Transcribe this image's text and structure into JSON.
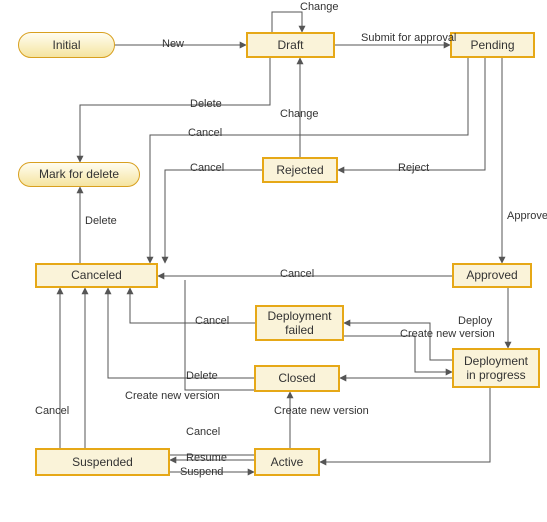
{
  "nodes": {
    "initial": "Initial",
    "draft": "Draft",
    "pending": "Pending",
    "rejected": "Rejected",
    "mark_for_delete": "Mark for delete",
    "canceled": "Canceled",
    "approved": "Approved",
    "deployment_failed": "Deployment failed",
    "deployment_in_progress": "Deployment in progress",
    "closed": "Closed",
    "active": "Active",
    "suspended": "Suspended"
  },
  "edges": {
    "new": "New",
    "change_self": "Change",
    "submit_for_approval": "Submit for approval",
    "reject": "Reject",
    "change_back": "Change",
    "delete_draft": "Delete",
    "cancel_pending": "Cancel",
    "cancel_rejected": "Cancel",
    "delete_canceled": "Delete",
    "approved_label": "Approved",
    "cancel_approved": "Cancel",
    "deploy": "Deploy",
    "cancel_depfail": "Cancel",
    "create_new_version_dip": "Create new version",
    "delete_closed": "Delete",
    "create_new_version_closed": "Create new version",
    "create_new_version_active": "Create new version",
    "cancel_active": "Cancel",
    "resume": "Resume",
    "suspend": "Suspend",
    "cancel_suspended": "Cancel"
  }
}
